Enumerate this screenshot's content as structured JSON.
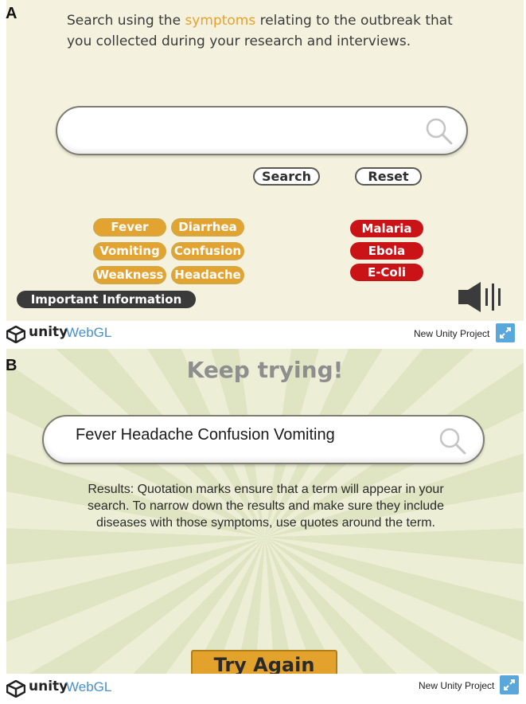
{
  "panel_labels": {
    "a": "A",
    "b": "B"
  },
  "panel_a": {
    "instruction_before": "Search using the ",
    "instruction_highlight": "symptoms",
    "instruction_after": " relating to the outbreak that you collected during your research and interviews.",
    "search_value": "",
    "search_button": "Search",
    "reset_button": "Reset",
    "symptoms": [
      "Fever",
      "Diarrhea",
      "Vomiting",
      "Confusion",
      "Weakness",
      "Headache"
    ],
    "diseases": [
      "Malaria",
      "Ebola",
      "E-Coli"
    ],
    "info_button": "Important Information",
    "icons": {
      "search": "magnifier-icon",
      "sound": "speaker-icon"
    }
  },
  "panel_b": {
    "title": "Keep trying!",
    "search_value": "Fever Headache Confusion Vomiting",
    "results_text": "Results: Quotation marks ensure that a term will appear in your search. To narrow down the results and make sure they include diseases with those symptoms, use quotes around the term.",
    "try_again": "Try Again"
  },
  "footer": {
    "brand": "unity",
    "product": "WebGL",
    "project": "New Unity Project",
    "icons": {
      "logo": "unity-logo-icon",
      "fullscreen": "fullscreen-icon"
    }
  },
  "colors": {
    "symptom_chip": "#e3a330",
    "disease_chip": "#c91317",
    "highlight": "#e8a12a",
    "panel_a_bg": "#f4f2de",
    "webgl_blue": "#4a90c8"
  }
}
